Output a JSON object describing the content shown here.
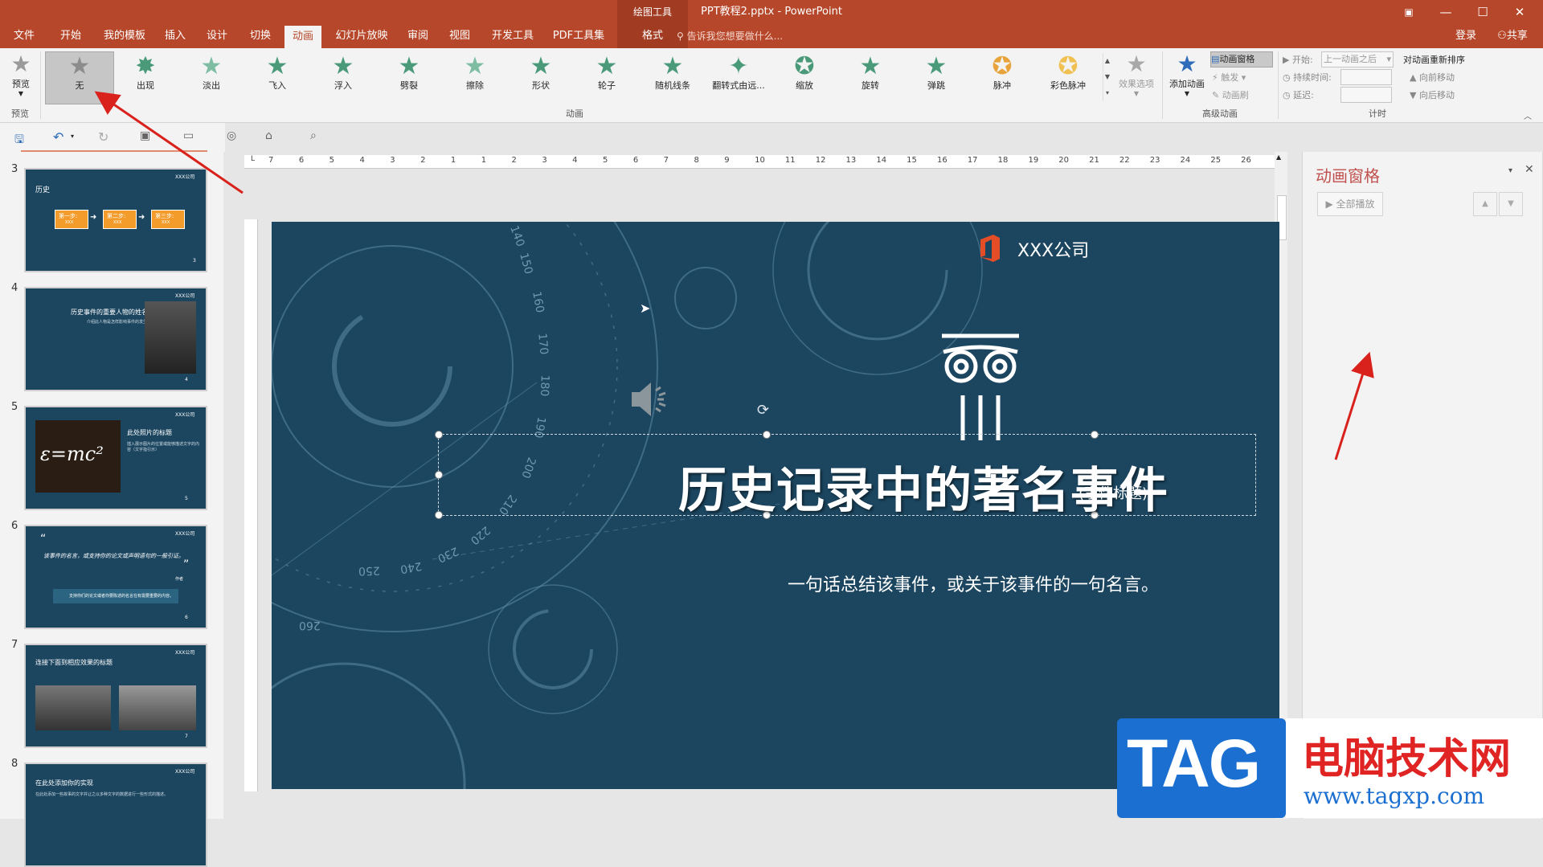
{
  "titlebar": {
    "context_group": "绘图工具",
    "document_title": "PPT教程2.pptx - PowerPoint",
    "restore_icon": "ribbon-display-icon",
    "min": "—",
    "max": "☐",
    "close": "✕"
  },
  "tabs": {
    "items": [
      "文件",
      "开始",
      "我的模板",
      "插入",
      "设计",
      "切换",
      "动画",
      "幻灯片放映",
      "审阅",
      "视图",
      "开发工具",
      "PDF工具集"
    ],
    "context_tab": "格式",
    "tell_me": "告诉我您想要做什么...",
    "login": "登录",
    "share": "共享"
  },
  "ribbon": {
    "preview_label": "预览",
    "preview_group": "预览",
    "effects": [
      "无",
      "出现",
      "淡出",
      "飞入",
      "浮入",
      "劈裂",
      "擦除",
      "形状",
      "轮子",
      "随机线条",
      "翻转式由远...",
      "缩放",
      "旋转",
      "弹跳",
      "脉冲",
      "彩色脉冲"
    ],
    "effect_options": "效果选项",
    "animation_group": "动画",
    "add_animation": "添加动画",
    "animation_pane_btn": "动画窗格",
    "trigger": "触发",
    "animation_painter": "动画刷",
    "advanced_group": "高级动画",
    "start_label": "开始:",
    "start_value": "上一动画之后",
    "duration_label": "持续时间:",
    "delay_label": "延迟:",
    "timing_group": "计时",
    "reorder_title": "对动画重新排序",
    "move_earlier": "向前移动",
    "move_later": "向后移动"
  },
  "ruler": {
    "labels": [
      "7",
      "6",
      "5",
      "4",
      "3",
      "2",
      "1",
      "1",
      "2",
      "3",
      "4",
      "5",
      "6",
      "7",
      "8",
      "9",
      "10",
      "11",
      "12",
      "13",
      "14",
      "15",
      "16",
      "17",
      "18",
      "19",
      "20",
      "21",
      "22",
      "23",
      "24",
      "25",
      "26"
    ]
  },
  "thumbnails": [
    {
      "num": "3",
      "title": "历史",
      "steps": [
        "第一步:",
        "第二步:",
        "第三步:"
      ],
      "step_sub": "XXX",
      "page": "3",
      "company": "XXX公司"
    },
    {
      "num": "4",
      "title": "历史事件的重要人物的姓名",
      "sub": "介绍此人物是怎样影响事件的发生。",
      "page": "4",
      "company": "XXX公司"
    },
    {
      "num": "5",
      "title": "此处照片的标题",
      "sub": "插入展示图片的位置或能够描述文字的内容（文字指引示）",
      "formula": "ε=mc²",
      "page": "5",
      "company": "XXX公司"
    },
    {
      "num": "6",
      "quote": "该事件的名言，或支持你的论文或声明语句的一般引证。",
      "author": "作者",
      "box": "支持你们的论文或者你要陈述的名言在有需要重要的内容。",
      "page": "6",
      "company": "XXX公司"
    },
    {
      "num": "7",
      "title": "连接下面到相应效果的标题",
      "sub": "",
      "page": "7",
      "company": "XXX公司"
    },
    {
      "num": "8",
      "title": "在此处添加你的实现",
      "sub": "在此处添加一些故事的文字并让之以多种文字的数据进行一些形式的描述。",
      "page": "8",
      "company": "XXX公司"
    }
  ],
  "slide": {
    "company": "XXX公司",
    "title": "历史记录中的著名事件",
    "title_tag": "(事件标题)",
    "subtitle": "一句话总结该事件，或关于该事件的一句名言。",
    "dial_numbers": [
      "150",
      "160",
      "170",
      "180",
      "190",
      "200",
      "210",
      "220",
      "230",
      "240",
      "250",
      "260",
      "140"
    ]
  },
  "anim_pane": {
    "title": "动画窗格",
    "play_all": "全部播放"
  },
  "watermark": {
    "tag": "TAG",
    "site_name": "电脑技术网",
    "url": "www.tagxp.com"
  },
  "colors": {
    "accent": "#b7472a",
    "slide_bg": "#1c4660",
    "effect_green": "#4a9a79",
    "arrow_red": "#d9221c"
  }
}
